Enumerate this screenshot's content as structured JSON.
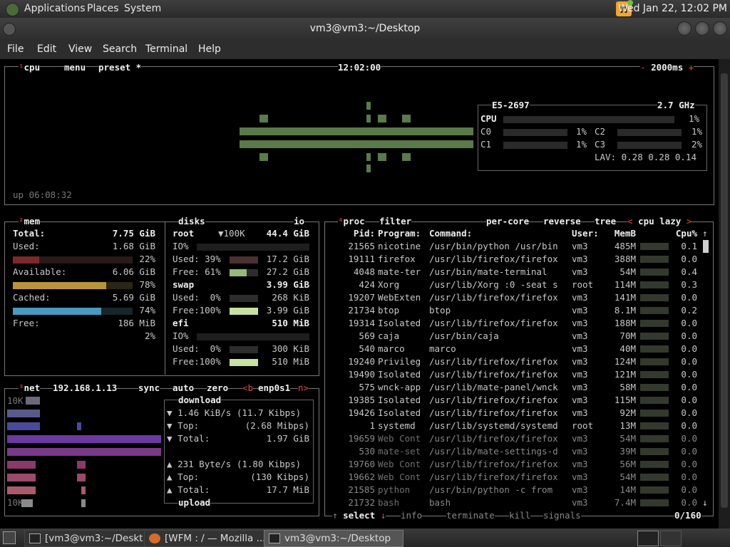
{
  "panel": {
    "menus": [
      "Applications",
      "Places",
      "System"
    ],
    "clock": "Wed Jan 22, 12:02 PM"
  },
  "window": {
    "title": "vm3@vm3:~/Desktop"
  },
  "menubar": [
    "File",
    "Edit",
    "View",
    "Search",
    "Terminal",
    "Help"
  ],
  "cpu": {
    "tab_num": "¹",
    "label": "cpu",
    "menu": "menu",
    "preset": "preset *",
    "time": "12:02:00",
    "minus": "-",
    "interval": "2000ms",
    "plus": "+",
    "uptime": "up 06:08:32",
    "model": "E5-2697",
    "freq": "2.7 GHz",
    "total_label": "CPU",
    "total_pct": "1%",
    "cores": [
      {
        "name": "C0",
        "pct": "1%"
      },
      {
        "name": "C1",
        "pct": "1%"
      },
      {
        "name": "C2",
        "pct": "1%"
      },
      {
        "name": "C3",
        "pct": "2%"
      }
    ],
    "lav": "LAV: 0.28 0.28 0.14"
  },
  "mem": {
    "tab_num": "²",
    "label": "mem",
    "total_label": "Total:",
    "total": "7.75 GiB",
    "used_label": "Used:",
    "used": "1.68 GiB",
    "used_pct": "22%",
    "used_frac": 0.22,
    "avail_label": "Available:",
    "avail": "6.06 GiB",
    "avail_pct": "78%",
    "avail_frac": 0.78,
    "cached_label": "Cached:",
    "cached": "5.69 GiB",
    "cached_pct": "74%",
    "cached_frac": 0.74,
    "free_label": "Free:",
    "free": "186 MiB",
    "free_pct": "2%"
  },
  "disks": {
    "label": "disks",
    "io": "io",
    "root": {
      "name": "root",
      "io_limit": "▼100K",
      "size": "44.4 GiB",
      "io_label": "IO%",
      "used_label": "Used: 39%",
      "used": "17.2 GiB",
      "free_label": "Free: 61%",
      "free": "27.2 GiB"
    },
    "swap": {
      "name": "swap",
      "size": "3.99 GiB",
      "used_label": "Used:  0%",
      "used": "268 KiB",
      "free_label": "Free:100%",
      "free": "3.99 GiB"
    },
    "efi": {
      "name": "efi",
      "size": "510 MiB",
      "io_label": "IO%",
      "used_label": "Used:  0%",
      "used": "300 KiB",
      "free_label": "Free:100%",
      "free": "510 MiB"
    }
  },
  "net": {
    "tab_num": "³",
    "label": "net",
    "ip": "192.168.1.13",
    "sync": "sync",
    "auto": "auto",
    "zero": "zero",
    "prev": "<b",
    "iface": "enp0s1",
    "next": "n>",
    "scale_top": "10K",
    "scale_bottom": "10K",
    "download_title": "download",
    "upload_title": "upload",
    "down_rate": "1.46 KiB/s (11.7 Kibps)",
    "down_top_label": "Top:",
    "down_top": "(2.68 Mibps)",
    "down_total_label": "Total:",
    "down_total": "1.97 GiB",
    "up_rate": "231 Byte/s (1.80 Kibps)",
    "up_top_label": "Top:",
    "up_top": "(130 Kibps)",
    "up_total_label": "Total:",
    "up_total": "17.7 MiB"
  },
  "proc": {
    "tab_num": "⁴",
    "label": "proc",
    "filter": "filter",
    "percore": "per-core",
    "reverse": "reverse",
    "tree": "tree",
    "sort": "cpu lazy",
    "headers": {
      "pid": "Pid:",
      "program": "Program:",
      "command": "Command:",
      "user": "User:",
      "mem": "MemB",
      "cpu": "Cpu%"
    },
    "rows": [
      {
        "pid": "21565",
        "program": "nicotine",
        "command": "/usr/bin/python /usr/bin",
        "user": "vm3",
        "mem": "485M",
        "cpu": "0.1"
      },
      {
        "pid": "19111",
        "program": "firefox",
        "command": "/usr/lib/firefox/firefox",
        "user": "vm3",
        "mem": "388M",
        "cpu": "0.0"
      },
      {
        "pid": "4048",
        "program": "mate-ter",
        "command": "/usr/bin/mate-terminal",
        "user": "vm3",
        "mem": "54M",
        "cpu": "0.4"
      },
      {
        "pid": "424",
        "program": "Xorg",
        "command": "/usr/lib/Xorg :0 -seat s",
        "user": "root",
        "mem": "114M",
        "cpu": "0.3"
      },
      {
        "pid": "19207",
        "program": "WebExten",
        "command": "/usr/lib/firefox/firefox",
        "user": "vm3",
        "mem": "141M",
        "cpu": "0.0"
      },
      {
        "pid": "21734",
        "program": "btop",
        "command": "btop",
        "user": "vm3",
        "mem": "8.1M",
        "cpu": "0.2"
      },
      {
        "pid": "19314",
        "program": "Isolated",
        "command": "/usr/lib/firefox/firefox",
        "user": "vm3",
        "mem": "188M",
        "cpu": "0.0"
      },
      {
        "pid": "569",
        "program": "caja",
        "command": "/usr/bin/caja",
        "user": "vm3",
        "mem": "70M",
        "cpu": "0.0"
      },
      {
        "pid": "540",
        "program": "marco",
        "command": "marco",
        "user": "vm3",
        "mem": "40M",
        "cpu": "0.0"
      },
      {
        "pid": "19240",
        "program": "Privileg",
        "command": "/usr/lib/firefox/firefox",
        "user": "vm3",
        "mem": "124M",
        "cpu": "0.0"
      },
      {
        "pid": "19490",
        "program": "Isolated",
        "command": "/usr/lib/firefox/firefox",
        "user": "vm3",
        "mem": "121M",
        "cpu": "0.0"
      },
      {
        "pid": "575",
        "program": "wnck-app",
        "command": "/usr/lib/mate-panel/wnck",
        "user": "vm3",
        "mem": "58M",
        "cpu": "0.0"
      },
      {
        "pid": "19385",
        "program": "Isolated",
        "command": "/usr/lib/firefox/firefox",
        "user": "vm3",
        "mem": "115M",
        "cpu": "0.0"
      },
      {
        "pid": "19426",
        "program": "Isolated",
        "command": "/usr/lib/firefox/firefox",
        "user": "vm3",
        "mem": "92M",
        "cpu": "0.0"
      },
      {
        "pid": "1",
        "program": "systemd",
        "command": "/usr/lib/systemd/systemd",
        "user": "root",
        "mem": "13M",
        "cpu": "0.0"
      },
      {
        "pid": "19659",
        "program": "Web Cont",
        "command": "/usr/lib/firefox/firefox",
        "user": "vm3",
        "mem": "54M",
        "cpu": "0.0"
      },
      {
        "pid": "530",
        "program": "mate-set",
        "command": "/usr/lib/mate-settings-d",
        "user": "vm3",
        "mem": "39M",
        "cpu": "0.0"
      },
      {
        "pid": "19760",
        "program": "Web Cont",
        "command": "/usr/lib/firefox/firefox",
        "user": "vm3",
        "mem": "56M",
        "cpu": "0.0"
      },
      {
        "pid": "19662",
        "program": "Web Cont",
        "command": "/usr/lib/firefox/firefox",
        "user": "vm3",
        "mem": "54M",
        "cpu": "0.0"
      },
      {
        "pid": "21585",
        "program": "python",
        "command": "/usr/bin/python -c from",
        "user": "vm3",
        "mem": "14M",
        "cpu": "0.0"
      },
      {
        "pid": "21732",
        "program": "bash",
        "command": "bash",
        "user": "vm3",
        "mem": "7.4M",
        "cpu": "0.0"
      }
    ],
    "footer": {
      "select": "select",
      "info": "info",
      "terminate": "terminate",
      "kill": "kill",
      "signals": "signals",
      "count": "0/160"
    }
  },
  "taskbar": {
    "tasks": [
      "[vm3@vm3:~/Deskt...",
      "[WFM : / — Mozilla ...",
      "vm3@vm3:~/Desktop"
    ]
  }
}
